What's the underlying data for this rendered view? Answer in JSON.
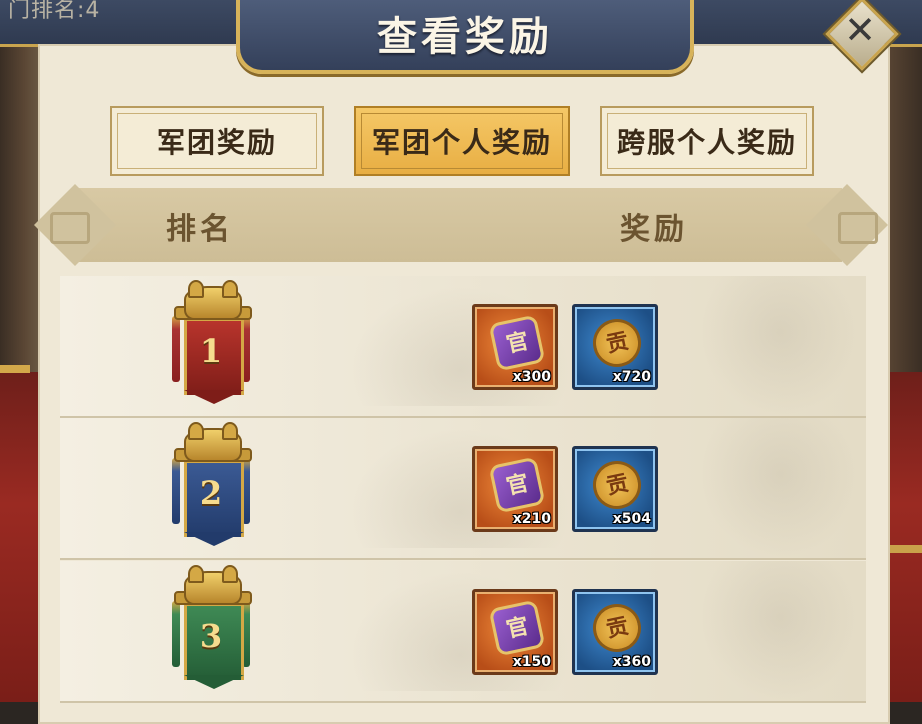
{
  "background": {
    "top_text": "门排名:4"
  },
  "dialog": {
    "title": "查看奖励",
    "close_icon": "close-icon"
  },
  "tabs": [
    {
      "label": "军团奖励",
      "active": false
    },
    {
      "label": "军团个人奖励",
      "active": true
    },
    {
      "label": "跨服个人奖励",
      "active": false
    }
  ],
  "table": {
    "headers": {
      "rank": "排名",
      "reward": "奖励"
    },
    "rows": [
      {
        "rank": "1",
        "banner_color": "red",
        "rewards": [
          {
            "icon": "purple-token-icon",
            "glyph": "官",
            "count": "x300"
          },
          {
            "icon": "gold-coin-icon",
            "glyph": "贡",
            "count": "x720"
          }
        ]
      },
      {
        "rank": "2",
        "banner_color": "blue",
        "rewards": [
          {
            "icon": "purple-token-icon",
            "glyph": "官",
            "count": "x210"
          },
          {
            "icon": "gold-coin-icon",
            "glyph": "贡",
            "count": "x504"
          }
        ]
      },
      {
        "rank": "3",
        "banner_color": "green",
        "rewards": [
          {
            "icon": "purple-token-icon",
            "glyph": "官",
            "count": "x150"
          },
          {
            "icon": "gold-coin-icon",
            "glyph": "贡",
            "count": "x360"
          }
        ]
      }
    ]
  },
  "colors": {
    "active_tab": "#e8ae43",
    "panel": "#efe8d6",
    "header": "#cdbd96",
    "title_bar": "#34405a"
  }
}
